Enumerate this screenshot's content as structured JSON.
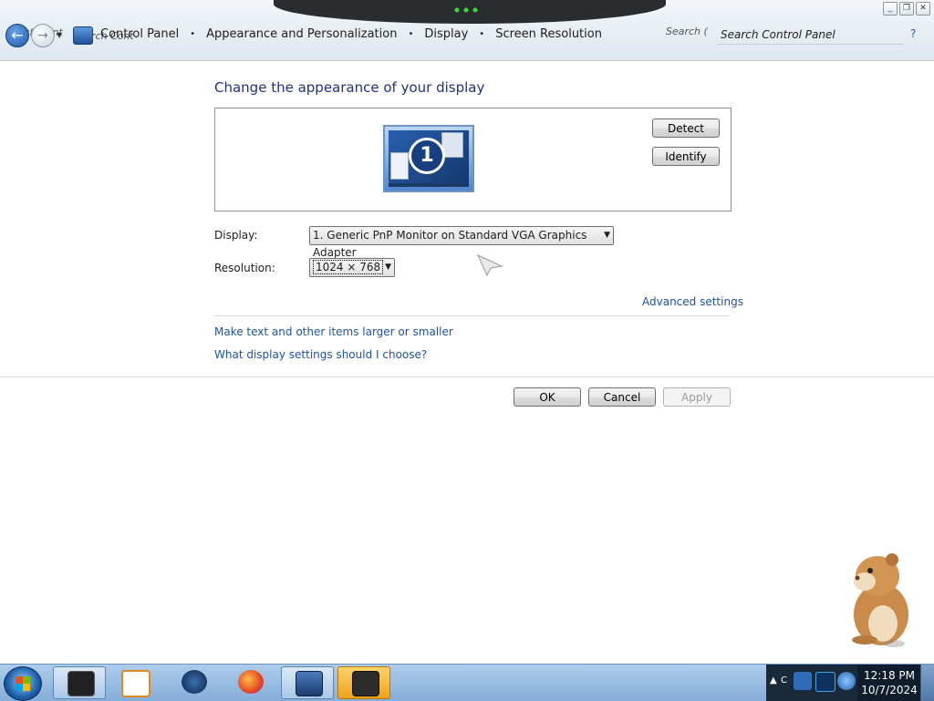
{
  "window": {
    "controls": [
      "_",
      "❐",
      "✕"
    ]
  },
  "addressbar": {
    "ghost_left": "rch Cont",
    "ghost_left2": "rch Cont",
    "crumbs": [
      "Control Panel",
      "Appearance and Personalization",
      "Display",
      "Screen Resolution"
    ],
    "separator": "•",
    "ghost_search": "Search (",
    "search_placeholder": "Search Control Panel"
  },
  "main": {
    "heading": "Change the appearance of your display",
    "monitor_number": "1",
    "detect_label": "Detect",
    "identify_label": "Identify",
    "display_label": "Display:",
    "display_value": "1. Generic PnP Monitor on Standard VGA Graphics Adapter",
    "resolution_label": "Resolution:",
    "resolution_value": "1024 × 768",
    "advanced_link": "Advanced settings",
    "link_text_size": "Make text and other items larger or smaller",
    "link_what_settings": "What display settings should I choose?",
    "ok_label": "OK",
    "cancel_label": "Cancel",
    "apply_label": "Apply"
  },
  "taskbar": {
    "time": "12:18 PM",
    "date": "10/7/2024",
    "tray_label": "C"
  },
  "colors": {
    "link": "#1e52a0",
    "heading": "#1e3287"
  }
}
